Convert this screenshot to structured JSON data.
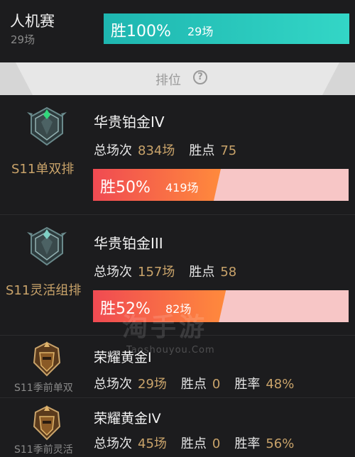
{
  "bot_match": {
    "title": "人机赛",
    "games": "29场",
    "win_label": "胜100%",
    "win_count": "29场",
    "win_rate": 1.0
  },
  "ranked_section": {
    "label": "排位",
    "help_icon": "?"
  },
  "queues": [
    {
      "mode": "S11单双排",
      "tier": "华贵铂金IV",
      "total_games_label": "总场次",
      "total_games": "834场",
      "lp_label": "胜点",
      "lp": "75",
      "win_label": "胜50%",
      "win_count": "419场",
      "win_rate": 0.5,
      "badge": "platinum-emblem-icon"
    },
    {
      "mode": "S11灵活组排",
      "tier": "华贵铂金III",
      "total_games_label": "总场次",
      "total_games": "157场",
      "lp_label": "胜点",
      "lp": "58",
      "win_label": "胜52%",
      "win_count": "82场",
      "win_rate": 0.52,
      "badge": "platinum-emblem-icon"
    },
    {
      "mode": "S11季前单双",
      "tier": "荣耀黄金I",
      "total_games_label": "总场次",
      "total_games": "29场",
      "lp_label": "胜点",
      "lp": "0",
      "rate_label": "胜率",
      "rate": "48%",
      "badge": "gold-emblem-icon"
    },
    {
      "mode": "S11季前灵活",
      "tier": "荣耀黄金IV",
      "total_games_label": "总场次",
      "total_games": "45场",
      "lp_label": "胜点",
      "lp": "0",
      "rate_label": "胜率",
      "rate": "56%",
      "badge": "gold-emblem-icon"
    }
  ],
  "watermark": {
    "logo_text": "淘手游",
    "url": "Taoshouyou.Com"
  },
  "colors": {
    "background": "#1c1c1e",
    "accent_gold": "#c9a36a",
    "bot_bar": "#1eb6b0",
    "win_bar_start": "#f04a52",
    "win_bar_end": "#ff8a3c",
    "win_bar_track": "#f7c6c6"
  }
}
